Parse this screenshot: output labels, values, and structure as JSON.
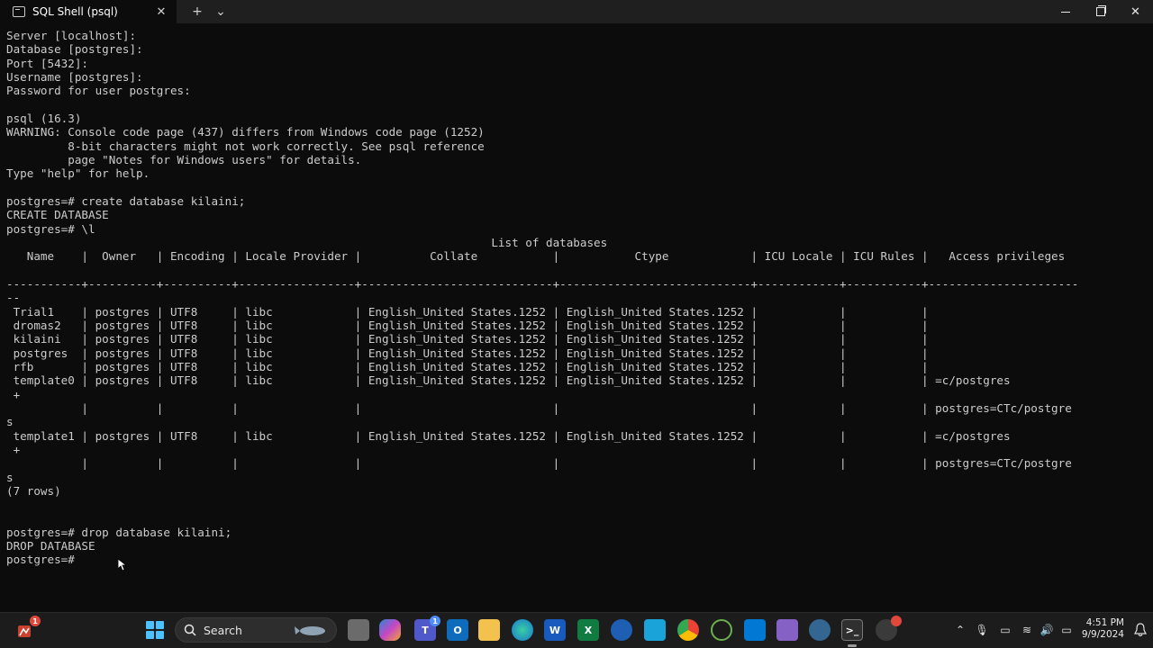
{
  "window": {
    "tab_title": "SQL Shell (psql)",
    "close_tab": "✕",
    "new_tab": "+",
    "dropdown": "⌄",
    "close_window": "✕"
  },
  "terminal": {
    "lines": [
      "Server [localhost]:",
      "Database [postgres]:",
      "Port [5432]:",
      "Username [postgres]:",
      "Password for user postgres:",
      "",
      "psql (16.3)",
      "WARNING: Console code page (437) differs from Windows code page (1252)",
      "         8-bit characters might not work correctly. See psql reference",
      "         page \"Notes for Windows users\" for details.",
      "Type \"help\" for help.",
      "",
      "postgres=# create database kilaini;",
      "CREATE DATABASE",
      "postgres=# \\l",
      "                                                                       List of databases",
      "   Name    |  Owner   | Encoding | Locale Provider |          Collate           |           Ctype            | ICU Locale | ICU Rules |   Access privileges",
      "",
      "-----------+----------+----------+-----------------+----------------------------+----------------------------+------------+-----------+----------------------",
      "--",
      " Trial1    | postgres | UTF8     | libc            | English_United States.1252 | English_United States.1252 |            |           |",
      " dromas2   | postgres | UTF8     | libc            | English_United States.1252 | English_United States.1252 |            |           |",
      " kilaini   | postgres | UTF8     | libc            | English_United States.1252 | English_United States.1252 |            |           |",
      " postgres  | postgres | UTF8     | libc            | English_United States.1252 | English_United States.1252 |            |           |",
      " rfb       | postgres | UTF8     | libc            | English_United States.1252 | English_United States.1252 |            |           |",
      " template0 | postgres | UTF8     | libc            | English_United States.1252 | English_United States.1252 |            |           | =c/postgres",
      " +",
      "           |          |          |                 |                            |                            |            |           | postgres=CTc/postgre",
      "s",
      " template1 | postgres | UTF8     | libc            | English_United States.1252 | English_United States.1252 |            |           | =c/postgres",
      " +",
      "           |          |          |                 |                            |                            |            |           | postgres=CTc/postgre",
      "s",
      "(7 rows)",
      "",
      "",
      "postgres=# drop database kilaini;",
      "DROP DATABASE",
      "postgres=#"
    ]
  },
  "taskbar": {
    "search_label": "Search",
    "notification_count": "1",
    "teams_badge": "1",
    "time": "4:51 PM",
    "date": "9/9/2024",
    "accent": "#4cc2ff"
  }
}
